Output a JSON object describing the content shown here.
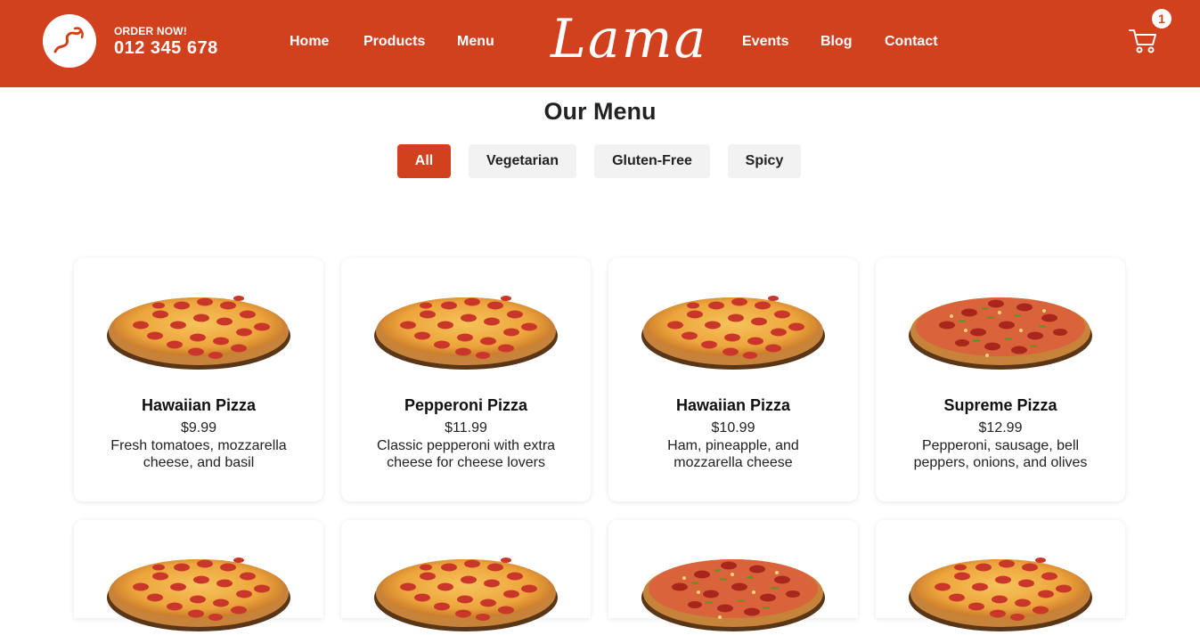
{
  "header": {
    "order_label": "ORDER NOW!",
    "order_number": "012 345 678",
    "logo": "Lama",
    "nav_left": [
      "Home",
      "Products",
      "Menu"
    ],
    "nav_right": [
      "Events",
      "Blog",
      "Contact"
    ],
    "cart_count": "1",
    "accent_color": "#d1411e"
  },
  "page": {
    "title": "Our Menu"
  },
  "filters": [
    {
      "label": "All",
      "active": true
    },
    {
      "label": "Vegetarian",
      "active": false
    },
    {
      "label": "Gluten-Free",
      "active": false
    },
    {
      "label": "Spicy",
      "active": false
    }
  ],
  "products": [
    {
      "name": "Hawaiian Pizza",
      "price": "$9.99",
      "description": "Fresh tomatoes, mozzarella cheese, and basil",
      "image": "pepperoni-pizza-image"
    },
    {
      "name": "Pepperoni Pizza",
      "price": "$11.99",
      "description": "Classic pepperoni with extra cheese for cheese lovers",
      "image": "pepperoni-pizza-image"
    },
    {
      "name": "Hawaiian Pizza",
      "price": "$10.99",
      "description": "Ham, pineapple, and mozzarella cheese",
      "image": "pepperoni-pizza-image"
    },
    {
      "name": "Supreme Pizza",
      "price": "$12.99",
      "description": "Pepperoni, sausage, bell peppers, onions, and olives",
      "image": "supreme-pizza-image"
    },
    {
      "image": "pepperoni-pizza-image"
    },
    {
      "image": "pepperoni-pizza-image"
    },
    {
      "image": "supreme-pizza-image"
    },
    {
      "image": "pepperoni-pizza-image"
    }
  ]
}
